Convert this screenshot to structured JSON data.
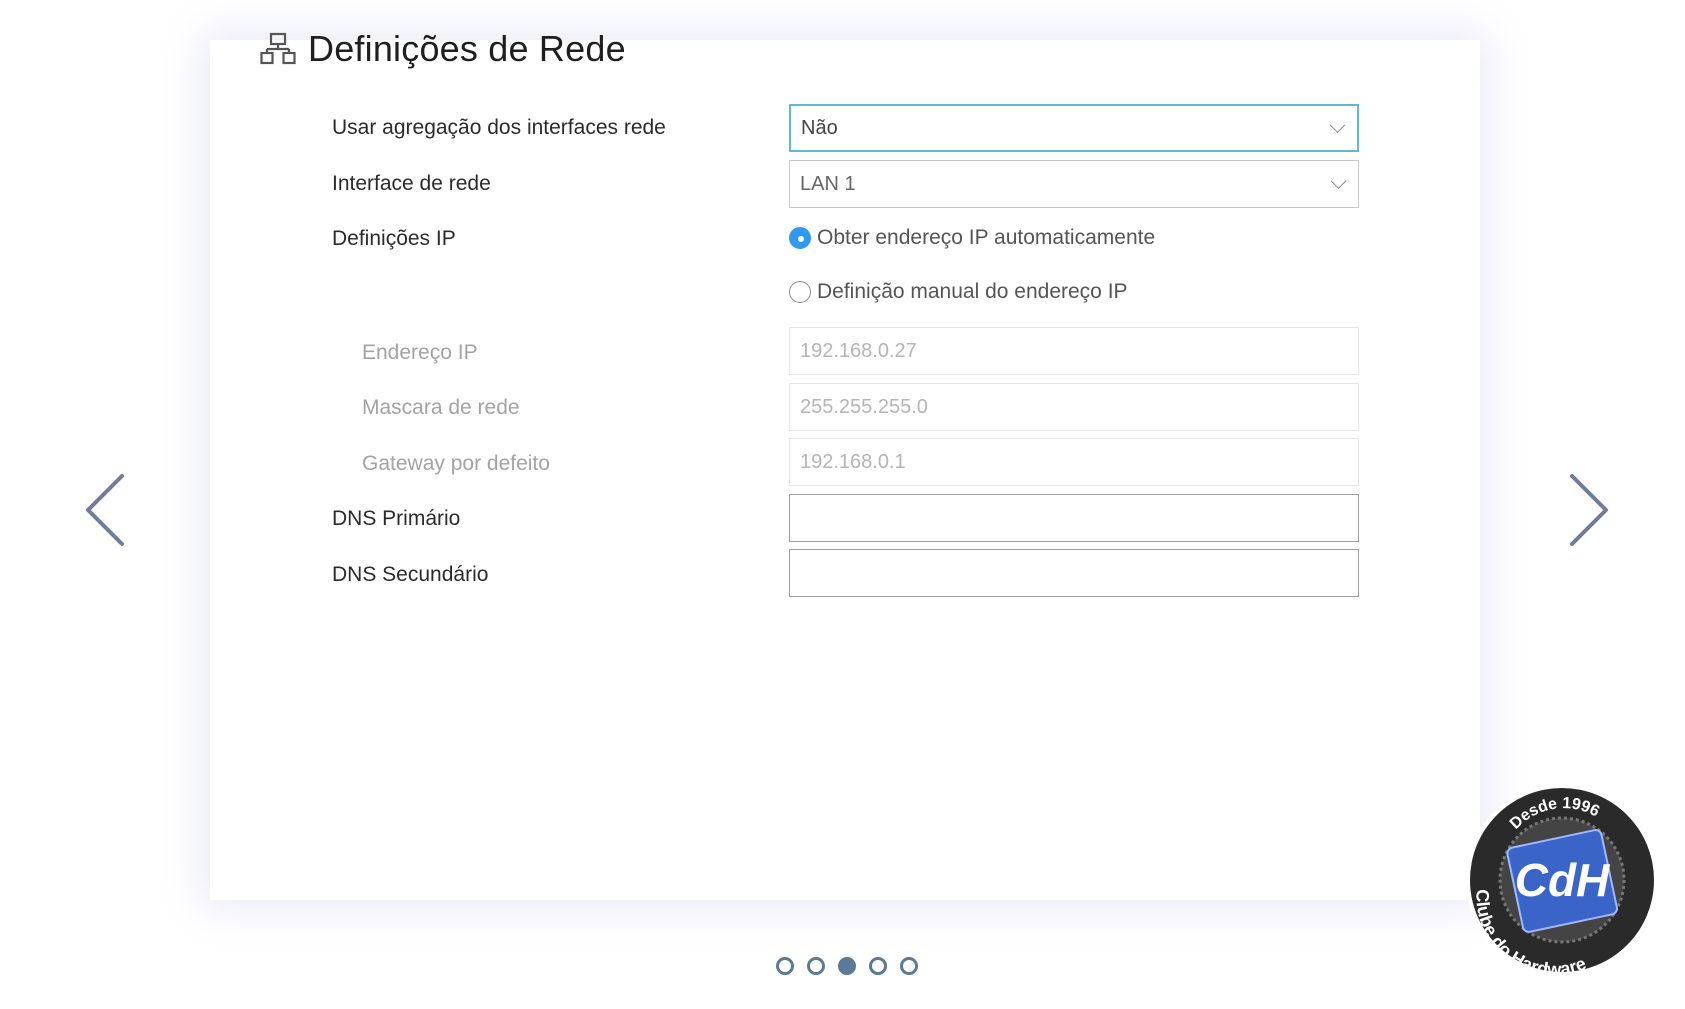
{
  "page": {
    "title": "Definições de Rede",
    "title_icon": "network-icon"
  },
  "form": {
    "link_aggregation": {
      "label": "Usar agregação dos interfaces rede",
      "value": "Não"
    },
    "interface": {
      "label": "Interface de rede",
      "value": "LAN 1"
    },
    "ip_settings": {
      "label": "Definições IP",
      "options": [
        {
          "label": "Obter endereço IP automaticamente",
          "checked": true
        },
        {
          "label": "Definição manual do endereço IP",
          "checked": false
        }
      ]
    },
    "ip_address": {
      "label": "Endereço IP",
      "value": "192.168.0.27"
    },
    "netmask": {
      "label": "Mascara de rede",
      "value": "255.255.255.0"
    },
    "gateway": {
      "label": "Gateway por defeito",
      "value": "192.168.0.1"
    },
    "dns_primary": {
      "label": "DNS Primário",
      "value": ""
    },
    "dns_secondary": {
      "label": "DNS Secundário",
      "value": ""
    }
  },
  "navigation": {
    "prev_icon": "chevron-left-icon",
    "next_icon": "chevron-right-icon",
    "page_dots": 5,
    "active_dot": 3
  },
  "watermark": {
    "top_text": "Desde 1996",
    "bottom_text": "Clube do Hardware",
    "logo_text": "CdH"
  },
  "colors": {
    "accent_radio": "#2f9bf0",
    "focus_border": "#5cb8d6",
    "dot_color": "#5b7a97",
    "arrow_color": "#6f7c9c"
  }
}
